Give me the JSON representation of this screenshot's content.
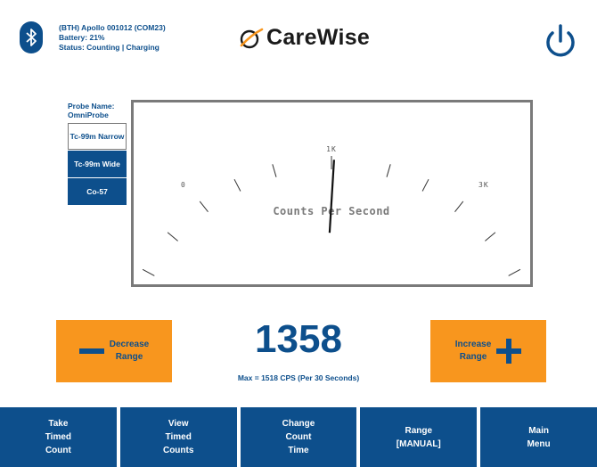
{
  "header": {
    "device_line": "(BTH) Apollo 001012 (COM23)",
    "battery_line": "Battery: 21%",
    "status_line": "Status: Counting | Charging",
    "logo_text": "CareWise"
  },
  "probe": {
    "label_line1": "Probe Name:",
    "label_line2": "OmniProbe",
    "buttons": [
      {
        "label": "Tc-99m Narrow",
        "selected": false
      },
      {
        "label": "Tc-99m Wide",
        "selected": true
      },
      {
        "label": "Co-57",
        "selected": true
      }
    ]
  },
  "gauge": {
    "min_label": "0",
    "mid_label": "1K",
    "max_label": "3K",
    "unit_label": "Counts Per Second",
    "needle_value": 1358,
    "scale_max": 3000
  },
  "controls": {
    "decrease_line1": "Decrease",
    "decrease_line2": "Range",
    "increase_line1": "Increase",
    "increase_line2": "Range",
    "reading": "1358",
    "max_text": "Max = 1518 CPS (Per 30 Seconds)"
  },
  "nav": [
    {
      "line1": "Take",
      "line2": "Timed",
      "line3": "Count"
    },
    {
      "line1": "View",
      "line2": "Timed",
      "line3": "Counts"
    },
    {
      "line1": "Change",
      "line2": "Count",
      "line3": "Time"
    },
    {
      "line1": "Range",
      "line2": "[MANUAL]",
      "line3": ""
    },
    {
      "line1": "Main",
      "line2": "Menu",
      "line3": ""
    }
  ],
  "colors": {
    "primary_blue": "#0d4f8c",
    "accent_orange": "#f8961e",
    "frame_gray": "#7a7a7a"
  },
  "icons": {
    "bluetooth": "bluetooth-icon",
    "power": "power-icon",
    "logo": "carewise-logo-icon",
    "minus": "minus-icon",
    "plus": "plus-icon"
  }
}
